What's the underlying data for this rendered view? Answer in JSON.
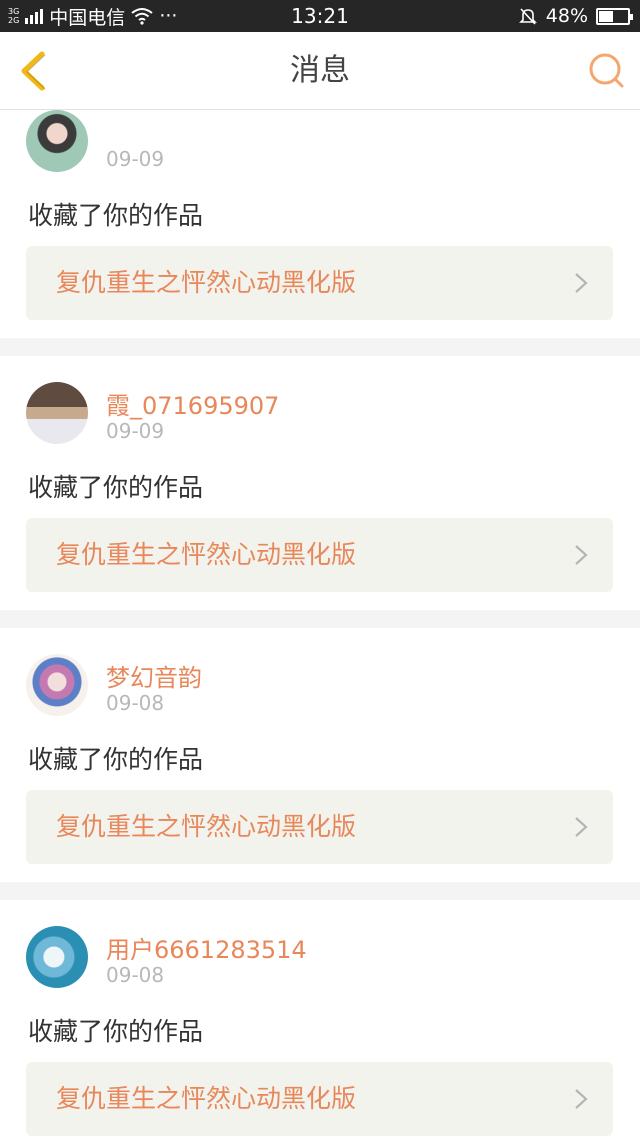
{
  "status_bar": {
    "network_top": "3G",
    "network_bottom": "2G",
    "carrier": "中国电信",
    "dots": "···",
    "time": "13:21",
    "battery": "48%",
    "battery_level": 0.48
  },
  "nav": {
    "title": "消息",
    "back_icon": "chevron-left-icon",
    "search_icon": "search-icon",
    "accent": "#f5a66e",
    "back_color": "#f2b817"
  },
  "messages": [
    {
      "user": "",
      "date": "09-09",
      "action": "收藏了你的作品",
      "work": "复仇重生之怦然心动黑化版"
    },
    {
      "user": "霞_071695907",
      "date": "09-09",
      "action": "收藏了你的作品",
      "work": "复仇重生之怦然心动黑化版"
    },
    {
      "user": "梦幻音韵",
      "date": "09-08",
      "action": "收藏了你的作品",
      "work": "复仇重生之怦然心动黑化版"
    },
    {
      "user": "用户6661283514",
      "date": "09-08",
      "action": "收藏了你的作品",
      "work": "复仇重生之怦然心动黑化版"
    }
  ],
  "colors": {
    "username": "#e8875a",
    "work_title": "#e8875a",
    "date": "#b8b8b8",
    "divider": "#f4f4f4"
  }
}
